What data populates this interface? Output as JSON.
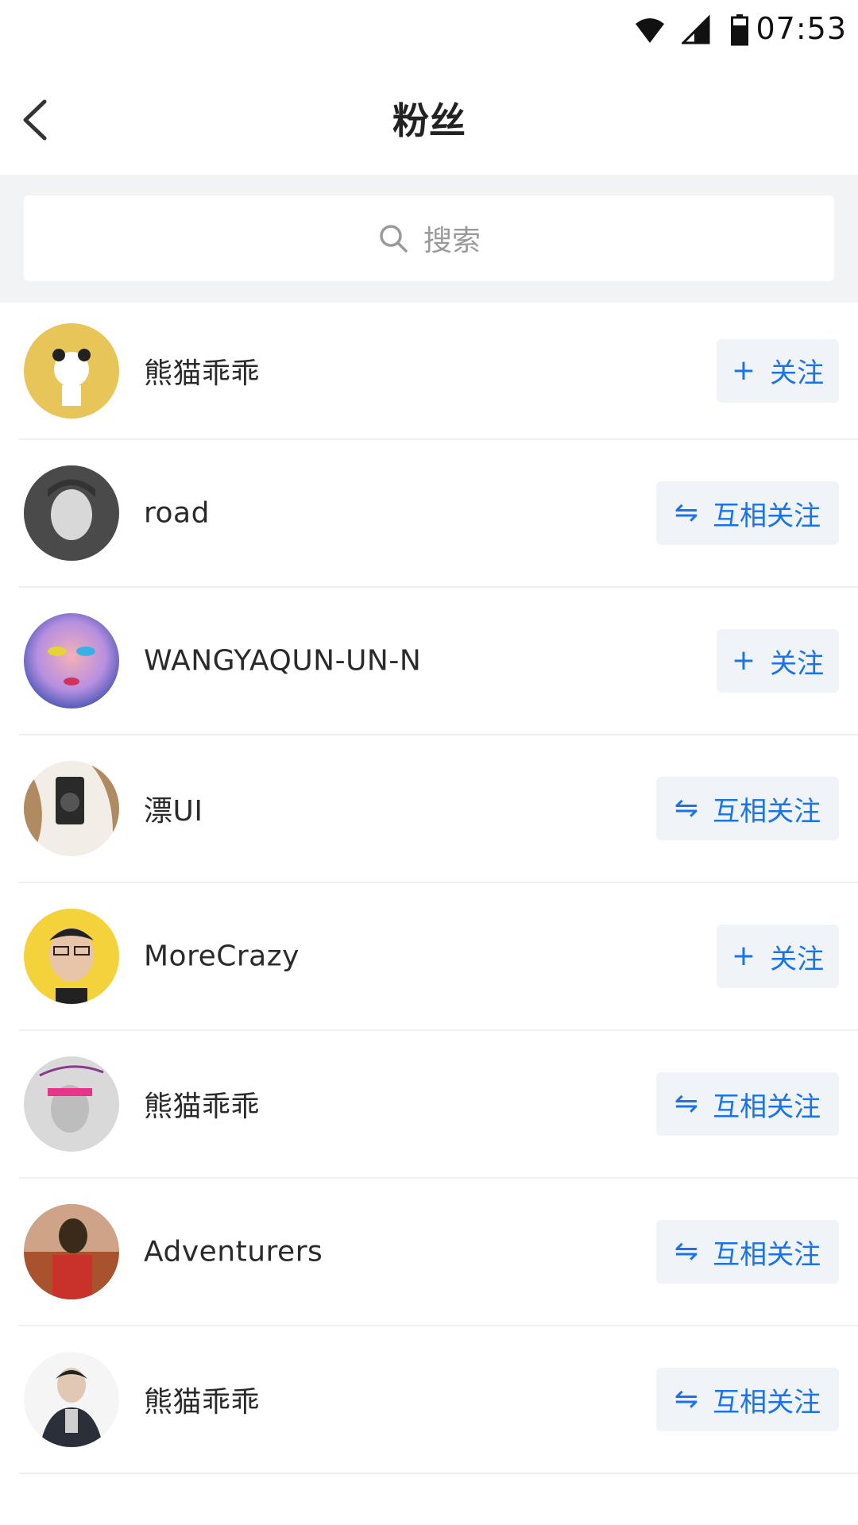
{
  "status_bar": {
    "time": "07:53"
  },
  "nav": {
    "title": "粉丝"
  },
  "search": {
    "placeholder": "搜索"
  },
  "fans": [
    {
      "name": "熊猫乖乖",
      "action_label": "关注",
      "action_icon": "+",
      "type": "follow",
      "avatar_color": "#e8c558"
    },
    {
      "name": "road",
      "action_label": "互相关注",
      "action_icon": "⇋",
      "type": "mutual",
      "avatar_color": "#6b6b6b"
    },
    {
      "name": "WANGYAQUN-UN-N",
      "action_label": "关注",
      "action_icon": "+",
      "type": "follow",
      "avatar_color": "#7a6fd0"
    },
    {
      "name": "漂UI",
      "action_label": "互相关注",
      "action_icon": "⇋",
      "type": "mutual",
      "avatar_color": "#b08a60"
    },
    {
      "name": "MoreCrazy",
      "action_label": "关注",
      "action_icon": "+",
      "type": "follow",
      "avatar_color": "#f3d23c"
    },
    {
      "name": "熊猫乖乖",
      "action_label": "互相关注",
      "action_icon": "⇋",
      "type": "mutual",
      "avatar_color": "#d9d9d9"
    },
    {
      "name": "Adventurers",
      "action_label": "互相关注",
      "action_icon": "⇋",
      "type": "mutual",
      "avatar_color": "#a8532e"
    },
    {
      "name": "熊猫乖乖",
      "action_label": "互相关注",
      "action_icon": "⇋",
      "type": "mutual",
      "avatar_color": "#cfcfcf"
    }
  ],
  "colors": {
    "accent": "#1a73e8",
    "button_bg": "#f0f4f8",
    "search_bg": "#f2f3f5"
  }
}
